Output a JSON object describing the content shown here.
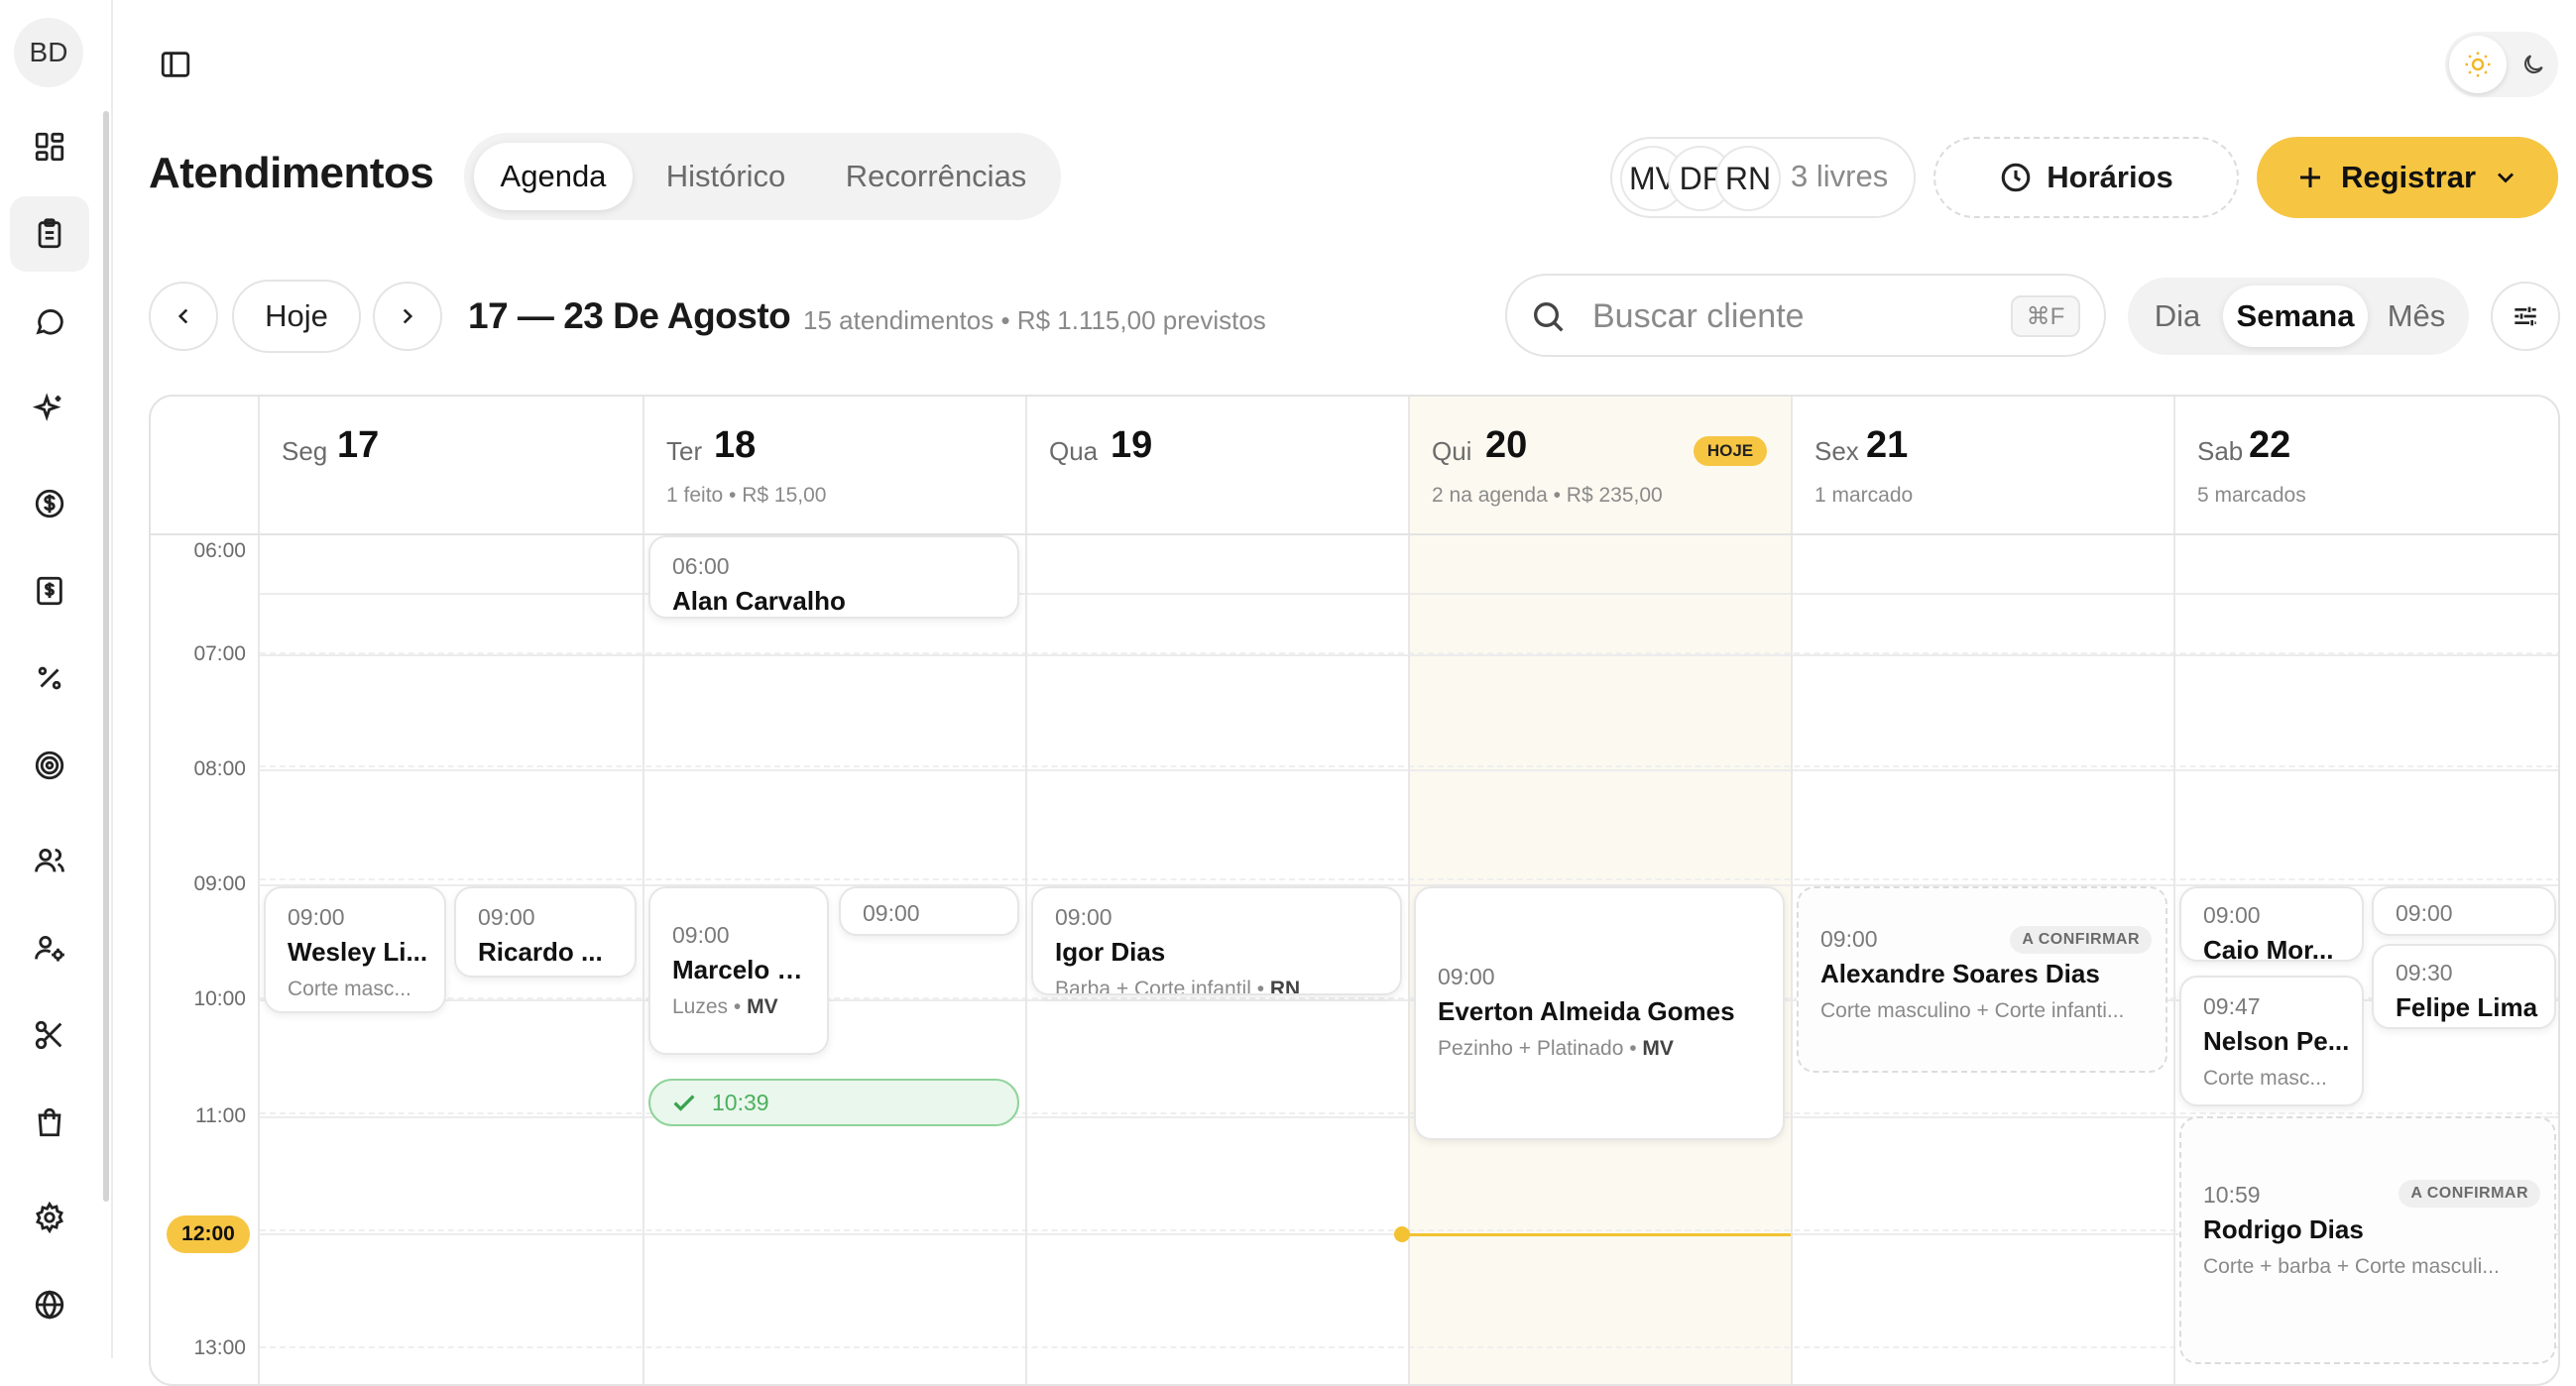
{
  "user": {
    "initials": "BD"
  },
  "sidebar": {
    "items": [
      {
        "icon": "dashboard-icon"
      },
      {
        "icon": "clipboard-icon",
        "active": true
      },
      {
        "icon": "chat-icon"
      },
      {
        "icon": "sparkles-icon"
      },
      {
        "icon": "dollar-circle-icon"
      },
      {
        "icon": "receipt-icon"
      },
      {
        "icon": "percent-icon"
      },
      {
        "icon": "target-icon"
      },
      {
        "icon": "users-icon"
      },
      {
        "icon": "user-settings-icon"
      },
      {
        "icon": "scissors-icon"
      },
      {
        "icon": "shopping-bag-icon"
      },
      {
        "icon": "gear-icon"
      },
      {
        "icon": "globe-icon"
      }
    ]
  },
  "header": {
    "title": "Atendimentos",
    "tabs": [
      {
        "label": "Agenda",
        "active": true
      },
      {
        "label": "Histórico"
      },
      {
        "label": "Recorrências"
      }
    ],
    "staff": {
      "avatars": [
        "MV",
        "DF",
        "RN"
      ],
      "free_label": "3 livres"
    },
    "horarios_label": "Horários",
    "registrar_label": "Registrar"
  },
  "toolbar": {
    "today_label": "Hoje",
    "range": "17 — 23 De Agosto",
    "summary": "15 atendimentos • R$ 1.115,00 previstos",
    "search_placeholder": "Buscar cliente",
    "search_shortcut": "⌘F",
    "views": [
      {
        "label": "Dia"
      },
      {
        "label": "Semana",
        "active": true
      },
      {
        "label": "Mês"
      }
    ]
  },
  "calendar": {
    "days": [
      {
        "name": "Seg",
        "num": "17",
        "sub": ""
      },
      {
        "name": "Ter",
        "num": "18",
        "sub": "1 feito • R$ 15,00"
      },
      {
        "name": "Qua",
        "num": "19",
        "sub": ""
      },
      {
        "name": "Qui",
        "num": "20",
        "sub": "2 na agenda • R$ 235,00",
        "today": true
      },
      {
        "name": "Sex",
        "num": "21",
        "sub": "1 marcado"
      },
      {
        "name": "Sab",
        "num": "22",
        "sub": "5 marcados"
      }
    ],
    "today_badge": "HOJE",
    "times": [
      "06:00",
      "07:00",
      "08:00",
      "09:00",
      "10:00",
      "11:00",
      "13:00"
    ],
    "now": "12:00",
    "accent": "#f6c542",
    "events": [
      {
        "time": "09:00",
        "name": "Wesley Li...",
        "sub": "Corte masc..."
      },
      {
        "time": "09:00",
        "name": "Ricardo ..."
      },
      {
        "time": "06:00",
        "name": "Alan Carvalho"
      },
      {
        "time": "09:00",
        "name": "Marcelo S...",
        "sub": "Luzes",
        "staff": "MV"
      },
      {
        "time": "09:00"
      },
      {
        "time": "09:00",
        "name": "Igor Dias",
        "sub": "Barba + Corte infantil",
        "staff": "RN"
      },
      {
        "time": "09:00",
        "name": "Everton Almeida Gomes",
        "sub": "Pezinho + Platinado",
        "staff": "MV"
      },
      {
        "time": "09:00",
        "name": "Alexandre Soares Dias",
        "sub": "Corte masculino + Corte infanti...",
        "badge": "A CONFIRMAR"
      },
      {
        "time": "09:00",
        "name": "Caio Mor..."
      },
      {
        "time": "09:00"
      },
      {
        "time": "09:30",
        "name": "Felipe Lima"
      },
      {
        "time": "09:47",
        "name": "Nelson Pe...",
        "sub": "Corte masc..."
      },
      {
        "time": "10:59",
        "name": "Rodrigo Dias",
        "sub": "Corte + barba + Corte masculi...",
        "badge": "A CONFIRMAR"
      }
    ],
    "done_event": {
      "time": "10:39",
      "status": "done"
    }
  }
}
